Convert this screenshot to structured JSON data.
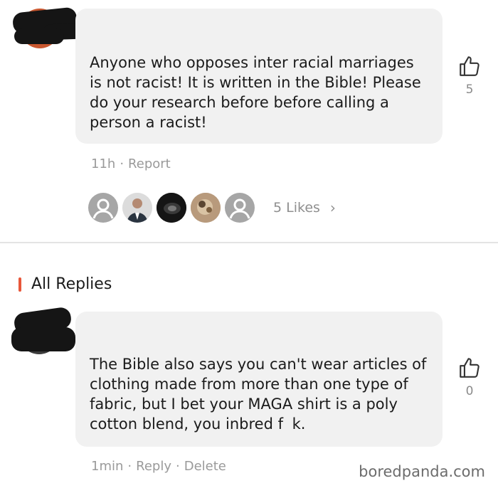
{
  "comment": {
    "text": "Anyone who opposes inter racial marriages\nis not racist! It is written in the Bible! Please\ndo your research before before calling a\nperson a racist!",
    "like_count": "5",
    "time": "11h",
    "report_label": "Report",
    "likes_label": "5 Likes"
  },
  "replies_section": {
    "title": "All Replies"
  },
  "reply": {
    "text": "The Bible also says you can't wear articles of\nclothing made from more than one type of\nfabric, but I bet your MAGA shirt is a poly\ncotton blend, you inbred f   k.",
    "like_count": "0",
    "time": "1min",
    "reply_label": "Reply",
    "delete_label": "Delete"
  },
  "watermark": "boredpanda.com",
  "colors": {
    "accent": "#e8573a",
    "bubble": "#f1f1f1",
    "muted": "#9a9a9a"
  }
}
